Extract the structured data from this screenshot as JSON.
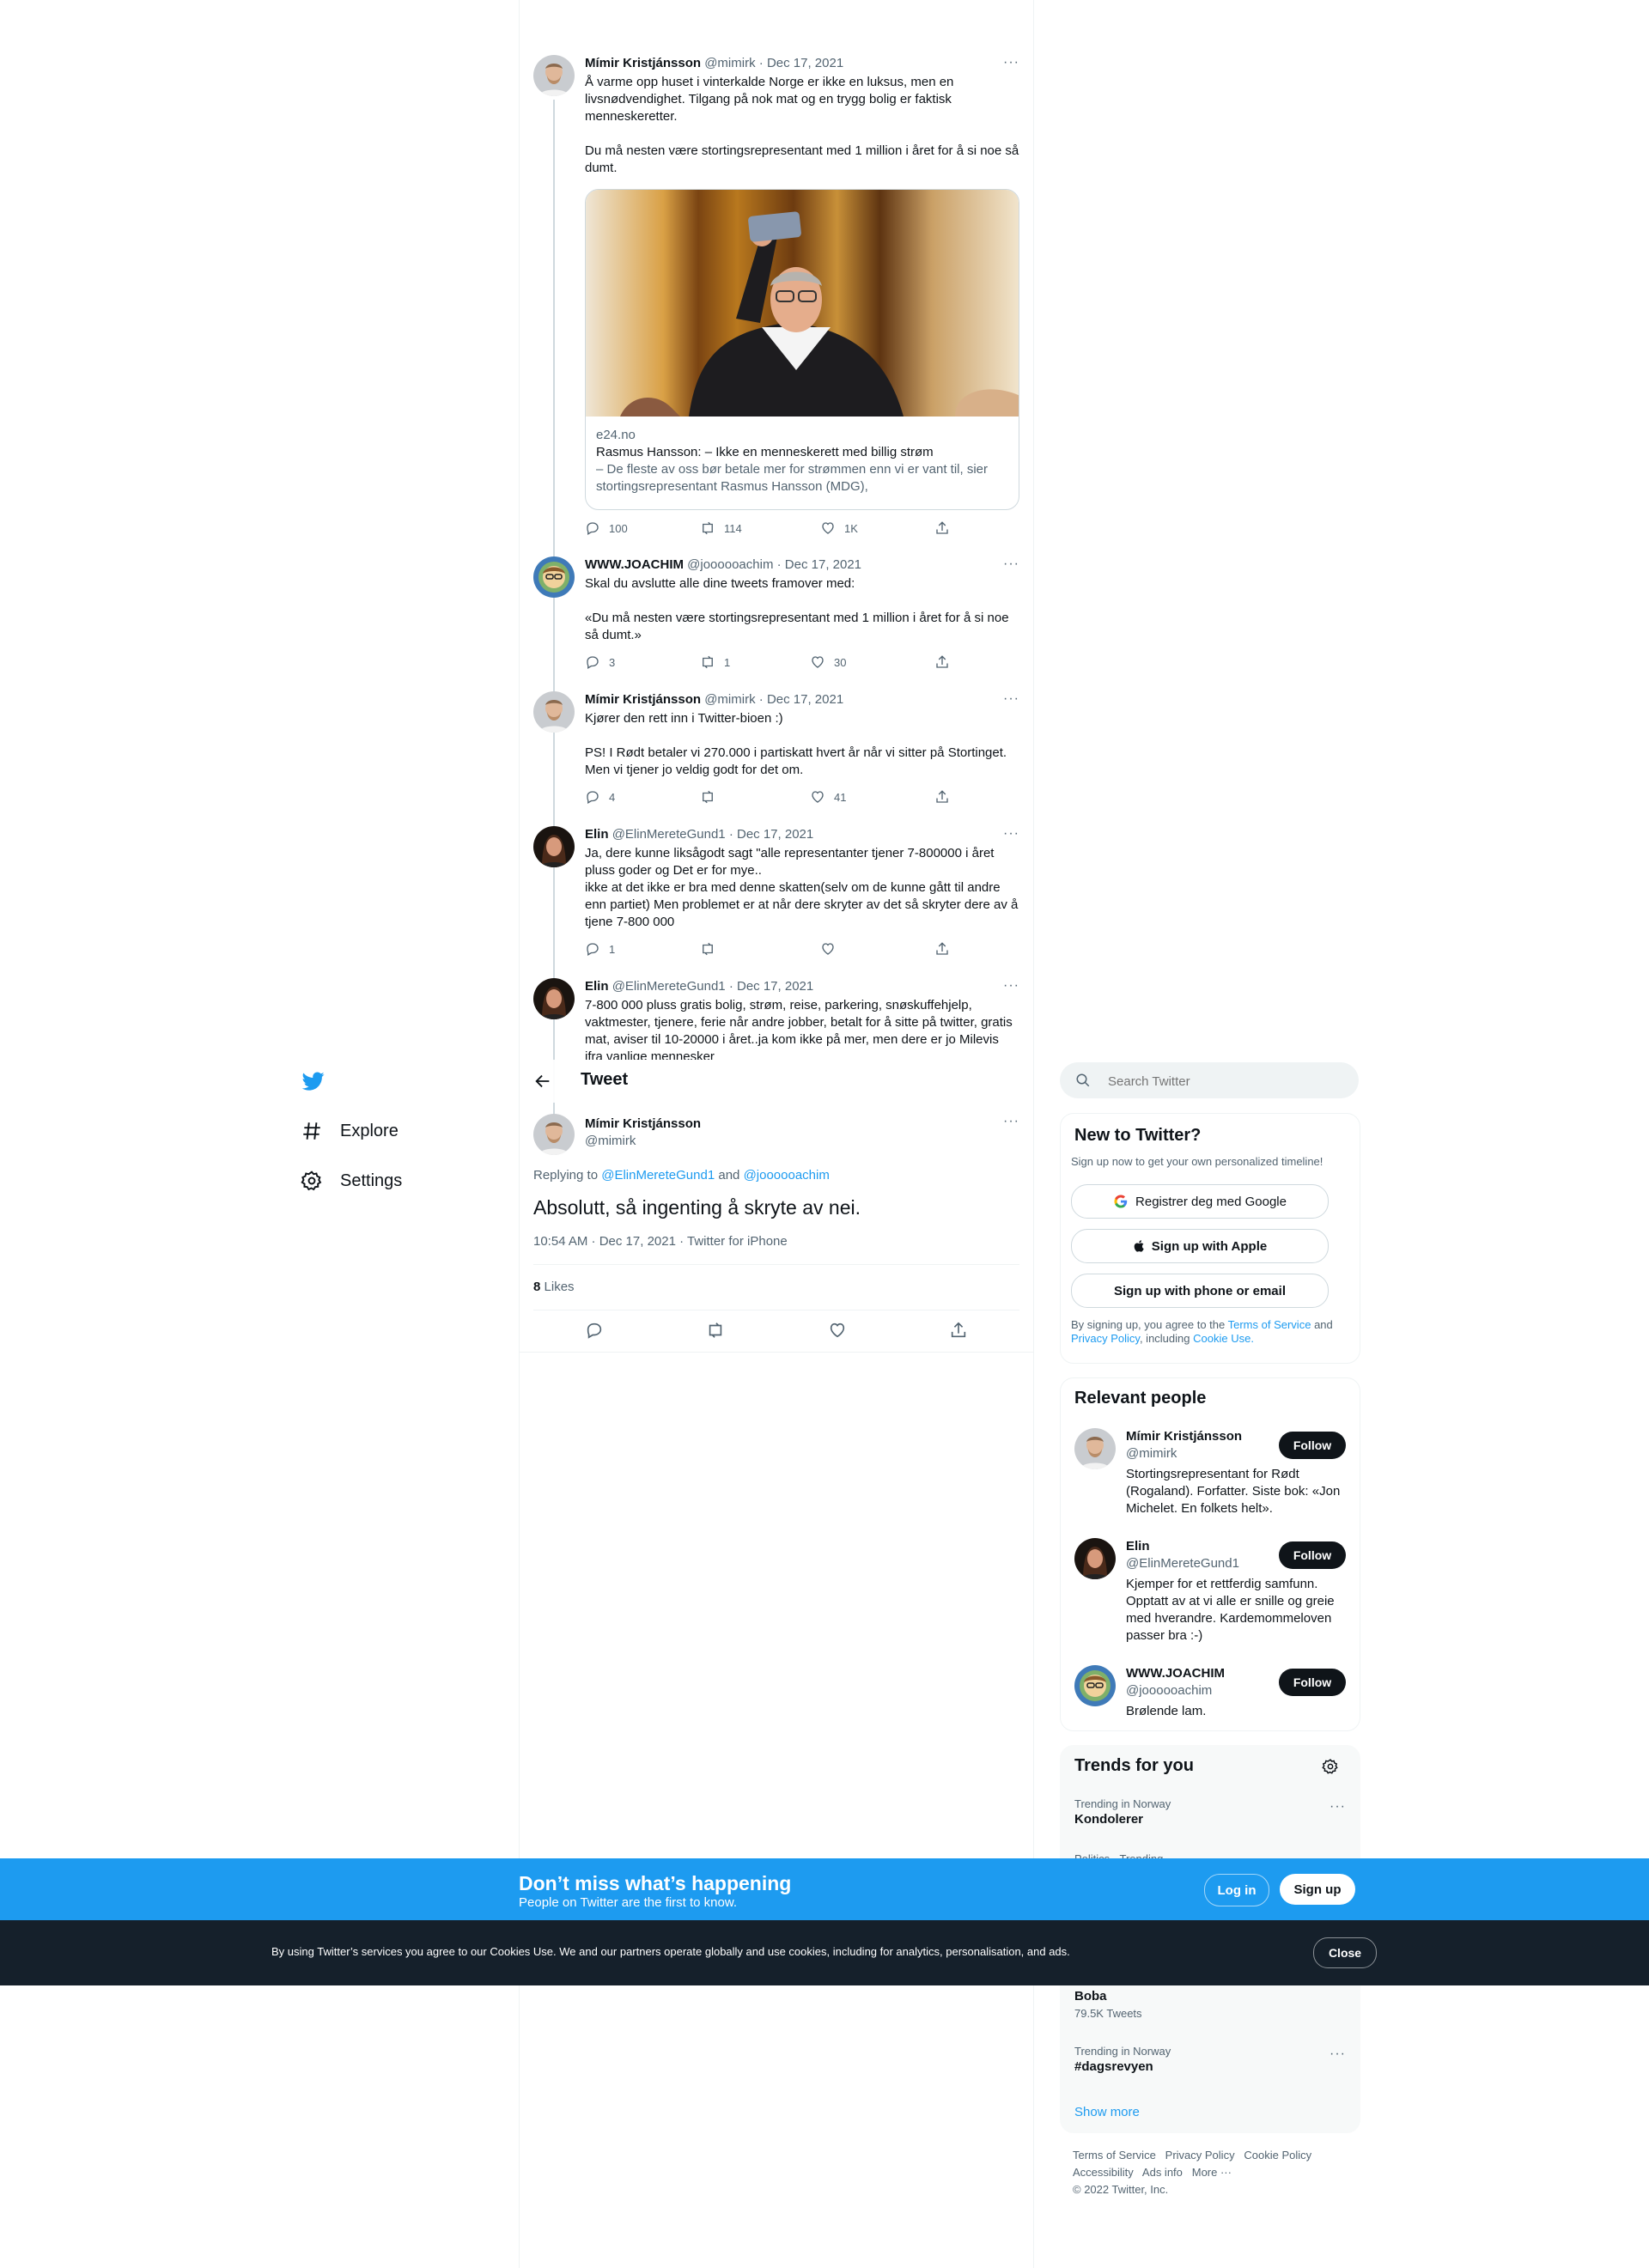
{
  "thread": [
    {
      "name": "Mímir Kristjánsson",
      "handle": "@mimirk",
      "date": "Dec 17, 2021",
      "text": "Å varme opp huset i vinterkalde Norge er ikke en luksus, men en livsnødvendighet. Tilgang på nok mat og en trygg bolig er faktisk menneskeretter.\n\nDu må nesten være stortingsrepresentant med 1 million i året for å si noe så dumt.",
      "card": {
        "domain": "e24.no",
        "title": "Rasmus Hansson: – Ikke en menneskerett med billig strøm",
        "description": "– De fleste av oss bør betale mer for strømmen enn vi er vant til, sier stortingsrepresentant Rasmus Hansson (MDG),"
      },
      "replies": "100",
      "retweets": "114",
      "likes": "1K"
    },
    {
      "name": "WWW.JOACHIM",
      "handle": "@joooooachim",
      "date": "Dec 17, 2021",
      "text": "Skal du avslutte alle dine tweets framover med:\n\n«Du må nesten være stortingsrepresentant med 1 million i året for å si noe så dumt.»",
      "replies": "3",
      "retweets": "1",
      "likes": "30"
    },
    {
      "name": "Mímir Kristjánsson",
      "handle": "@mimirk",
      "date": "Dec 17, 2021",
      "text": "Kjører den rett inn i Twitter-bioen :)\n\nPS! I Rødt betaler vi 270.000 i partiskatt hvert år når vi sitter på Stortinget. Men vi tjener jo veldig godt for det om.",
      "replies": "4",
      "retweets": "",
      "likes": "41"
    },
    {
      "name": "Elin",
      "handle": "@ElinMereteGund1",
      "date": "Dec 17, 2021",
      "text": "Ja, dere kunne liksågodt sagt \"alle representanter tjener 7-800000 i året pluss goder og Det er for mye..\nikke at det ikke er bra med denne skatten(selv om de kunne gått til andre enn partiet) Men problemet er at når dere skryter av det så skryter dere av å tjene 7-800 000",
      "replies": "1",
      "retweets": "",
      "likes": ""
    },
    {
      "name": "Elin",
      "handle": "@ElinMereteGund1",
      "date": "Dec 17, 2021",
      "text": "7-800 000 pluss gratis bolig, strøm, reise, parkering, snøskuffehjelp, vaktmester, tjenere, ferie når andre jobber, betalt for å sitte på twitter, gratis mat, aviser til 10-20000 i året..ja kom ikke på mer, men dere er jo Milevis ifra vanlige mennesker"
    }
  ],
  "header": {
    "title": "Tweet"
  },
  "sidebar": {
    "items": [
      {
        "label": "Explore"
      },
      {
        "label": "Settings"
      }
    ]
  },
  "main_tweet": {
    "name": "Mímir Kristjánsson",
    "handle": "@mimirk",
    "replying_prefix": "Replying to",
    "replying_to_1": "@ElinMereteGund1",
    "replying_and": "and",
    "replying_to_2": "@joooooachim",
    "text": "Absolutt, så ingenting å skryte av nei.",
    "time": "10:54 AM · Dec 17, 2021 · Twitter for iPhone",
    "likes_count": "8",
    "likes_label": "Likes"
  },
  "search": {
    "placeholder": "Search Twitter"
  },
  "new_to_twitter": {
    "title": "New to Twitter?",
    "subtitle": "Sign up now to get your own personalized timeline!",
    "google": "Registrer deg med Google",
    "apple": "Sign up with Apple",
    "phone": "Sign up with phone or email",
    "legal_1": "By signing up, you agree to the",
    "terms": "Terms of Service",
    "and": "and",
    "privacy": "Privacy Policy",
    "including": ", including",
    "cookie": "Cookie Use."
  },
  "relevant": {
    "title": "Relevant people",
    "follow_label": "Follow",
    "people": [
      {
        "name": "Mímir Kristjánsson",
        "handle": "@mimirk",
        "bio": "Stortingsrepresentant for Rødt (Rogaland). Forfatter. Siste bok: «Jon Michelet. En folkets helt»."
      },
      {
        "name": "Elin",
        "handle": "@ElinMereteGund1",
        "bio": "Kjemper for et rettferdig samfunn. Opptatt av at vi alle er snille og greie med hverandre. Kardemommeloven passer bra :-)"
      },
      {
        "name": "WWW.JOACHIM",
        "handle": "@joooooachim",
        "bio": "Brølende lam."
      }
    ]
  },
  "trends": {
    "title": "Trends for you",
    "items": [
      {
        "context": "Trending in Norway",
        "name": "Kondolerer",
        "count": ""
      },
      {
        "context": "Politics · Trending",
        "name": "",
        "count": ""
      },
      {
        "context": "",
        "name": "Boba",
        "count": "79.5K Tweets"
      },
      {
        "context": "Trending in Norway",
        "name": "#dagsrevyen",
        "count": ""
      }
    ],
    "show_more": "Show more"
  },
  "footer": {
    "links": [
      "Terms of Service",
      "Privacy Policy",
      "Cookie Policy",
      "Accessibility",
      "Ads info",
      "More ···"
    ],
    "copyright": "© 2022 Twitter, Inc."
  },
  "signup_bar": {
    "title": "Don’t miss what’s happening",
    "subtitle": "People on Twitter are the first to know.",
    "login": "Log in",
    "signup": "Sign up"
  },
  "cookie_bar": {
    "text": "By using Twitter’s services you agree to our Cookies Use. We and our partners operate globally and use cookies, including for analytics, personalisation, and ads.",
    "close": "Close"
  },
  "colors": {
    "accent": "#1d9bf0",
    "text": "#0f1419",
    "secondary": "#536471",
    "dark": "#0f1419"
  }
}
